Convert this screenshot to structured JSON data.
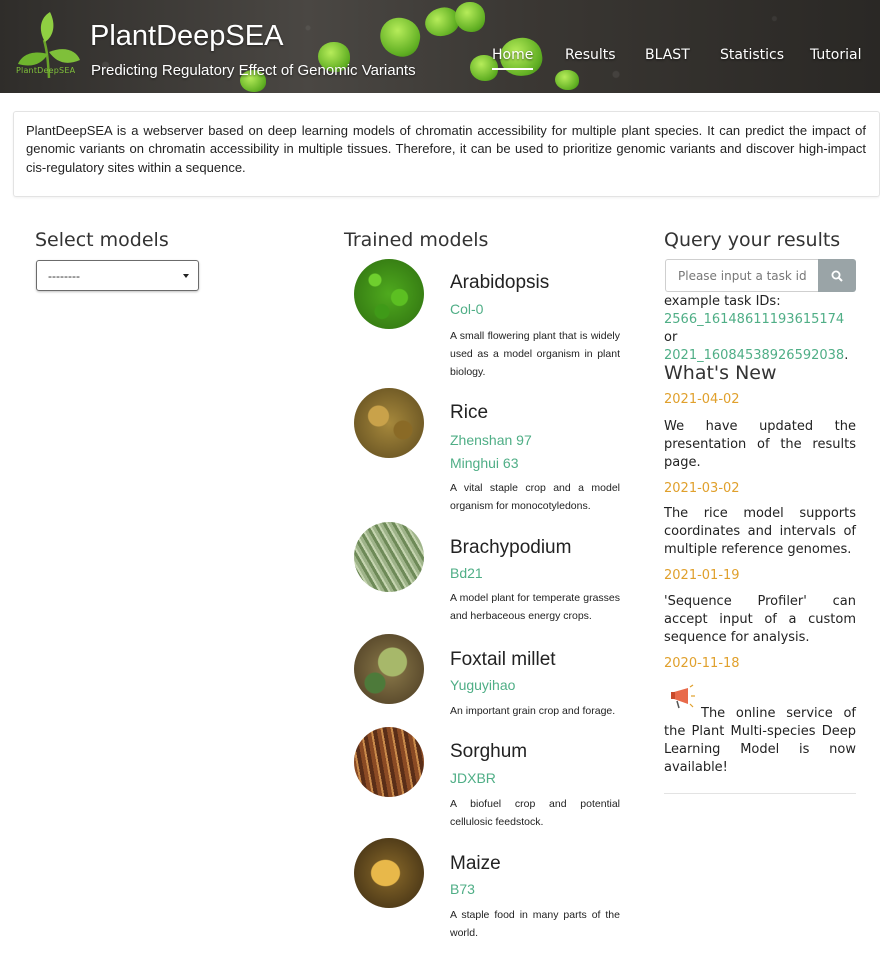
{
  "header": {
    "logo_text": "PlantDeepSEA",
    "title": "PlantDeepSEA",
    "subtitle": "Predicting Regulatory Effect of Genomic Variants",
    "nav": [
      {
        "label": "Home",
        "active": true
      },
      {
        "label": "Results",
        "active": false
      },
      {
        "label": "BLAST",
        "active": false
      },
      {
        "label": "Statistics",
        "active": false
      },
      {
        "label": "Tutorial",
        "active": false
      }
    ]
  },
  "intro": {
    "text": "PlantDeepSEA is a webserver based on deep learning models of chromatin accessibility for multiple plant species. It can predict the impact of genomic variants on chromatin accessibility in multiple tissues. Therefore, it can be used to prioritize genomic variants and discover high-impact cis-regulatory sites within a sequence."
  },
  "select_models": {
    "heading": "Select models",
    "selected_value": "--------"
  },
  "trained_models": {
    "heading": "Trained models",
    "items": [
      {
        "name": "Arabidopsis",
        "varieties": [
          "Col-0"
        ],
        "description": "A small flowering plant that is widely used as a model organism in plant biology."
      },
      {
        "name": "Rice",
        "varieties": [
          "Zhenshan 97",
          "Minghui 63"
        ],
        "description": "A vital staple crop and a model organism for monocotyledons."
      },
      {
        "name": "Brachypodium",
        "varieties": [
          "Bd21"
        ],
        "description": "A model plant for temperate grasses and herbaceous energy crops."
      },
      {
        "name": "Foxtail millet",
        "varieties": [
          "Yuguyihao"
        ],
        "description": "An important grain crop and forage."
      },
      {
        "name": "Sorghum",
        "varieties": [
          "JDXBR"
        ],
        "description": "A biofuel crop and potential cellulosic feedstock."
      },
      {
        "name": "Maize",
        "varieties": [
          "B73"
        ],
        "description": "A staple food in many parts of the world."
      }
    ]
  },
  "query": {
    "heading": "Query your results",
    "placeholder": "Please input a task id",
    "search_icon": "search-icon",
    "example_label": "example task IDs:",
    "example_ids": [
      "2566_16148611193615174",
      "2021_16084538926592038"
    ],
    "or_text": "or",
    "period": "."
  },
  "whats_new": {
    "heading": "What's New",
    "items": [
      {
        "date": "2021-04-02",
        "text": "We have updated the presentation of the results page."
      },
      {
        "date": "2021-03-02",
        "text": "The rice model supports coordinates and intervals of multiple reference genomes."
      },
      {
        "date": "2021-01-19",
        "text": "'Sequence Profiler' can accept input of a custom sequence for analysis."
      },
      {
        "date": "2020-11-18",
        "text": "The online service of the Plant Multi-species Deep Learning Model is now available!",
        "icon": "megaphone-icon"
      }
    ]
  },
  "colors": {
    "accent_green": "#4fae86",
    "date_orange": "#e0a02c",
    "search_button": "#9aa4a7"
  }
}
